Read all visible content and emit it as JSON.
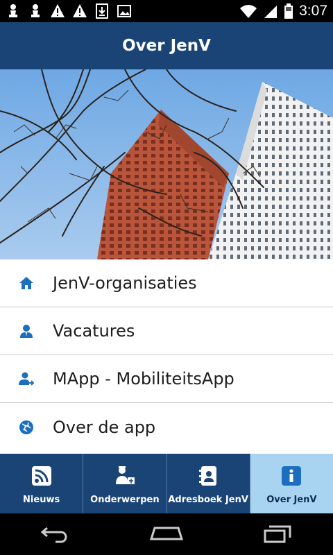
{
  "status_bar": {
    "time": "3:07",
    "left_icons": [
      "chess-pawn-icon",
      "chess-pawn-icon",
      "warning-icon",
      "warning-icon",
      "download-icon",
      "image-icon"
    ],
    "right_icons": [
      "wifi-icon",
      "signal-icon",
      "battery-icon"
    ]
  },
  "app_bar": {
    "title": "Over JenV"
  },
  "menu": {
    "items": [
      {
        "label": "JenV-organisaties",
        "icon": "home-icon"
      },
      {
        "label": "Vacatures",
        "icon": "person-icon"
      },
      {
        "label": "MApp - MobiliteitsApp",
        "icon": "person-arrow-icon"
      },
      {
        "label": "Over de app",
        "icon": "globe-icon"
      }
    ]
  },
  "tabs": [
    {
      "label": "Nieuws",
      "icon": "rss-icon",
      "active": false
    },
    {
      "label": "Onderwerpen",
      "icon": "justice-icon",
      "active": false
    },
    {
      "label": "Adresboek JenV",
      "icon": "address-book-icon",
      "active": false
    },
    {
      "label": "Over JenV",
      "icon": "info-icon",
      "active": true
    }
  ],
  "colors": {
    "brand": "#1a4476",
    "active_tab": "#a9d4f1",
    "icon_blue": "#1c6fbf"
  }
}
